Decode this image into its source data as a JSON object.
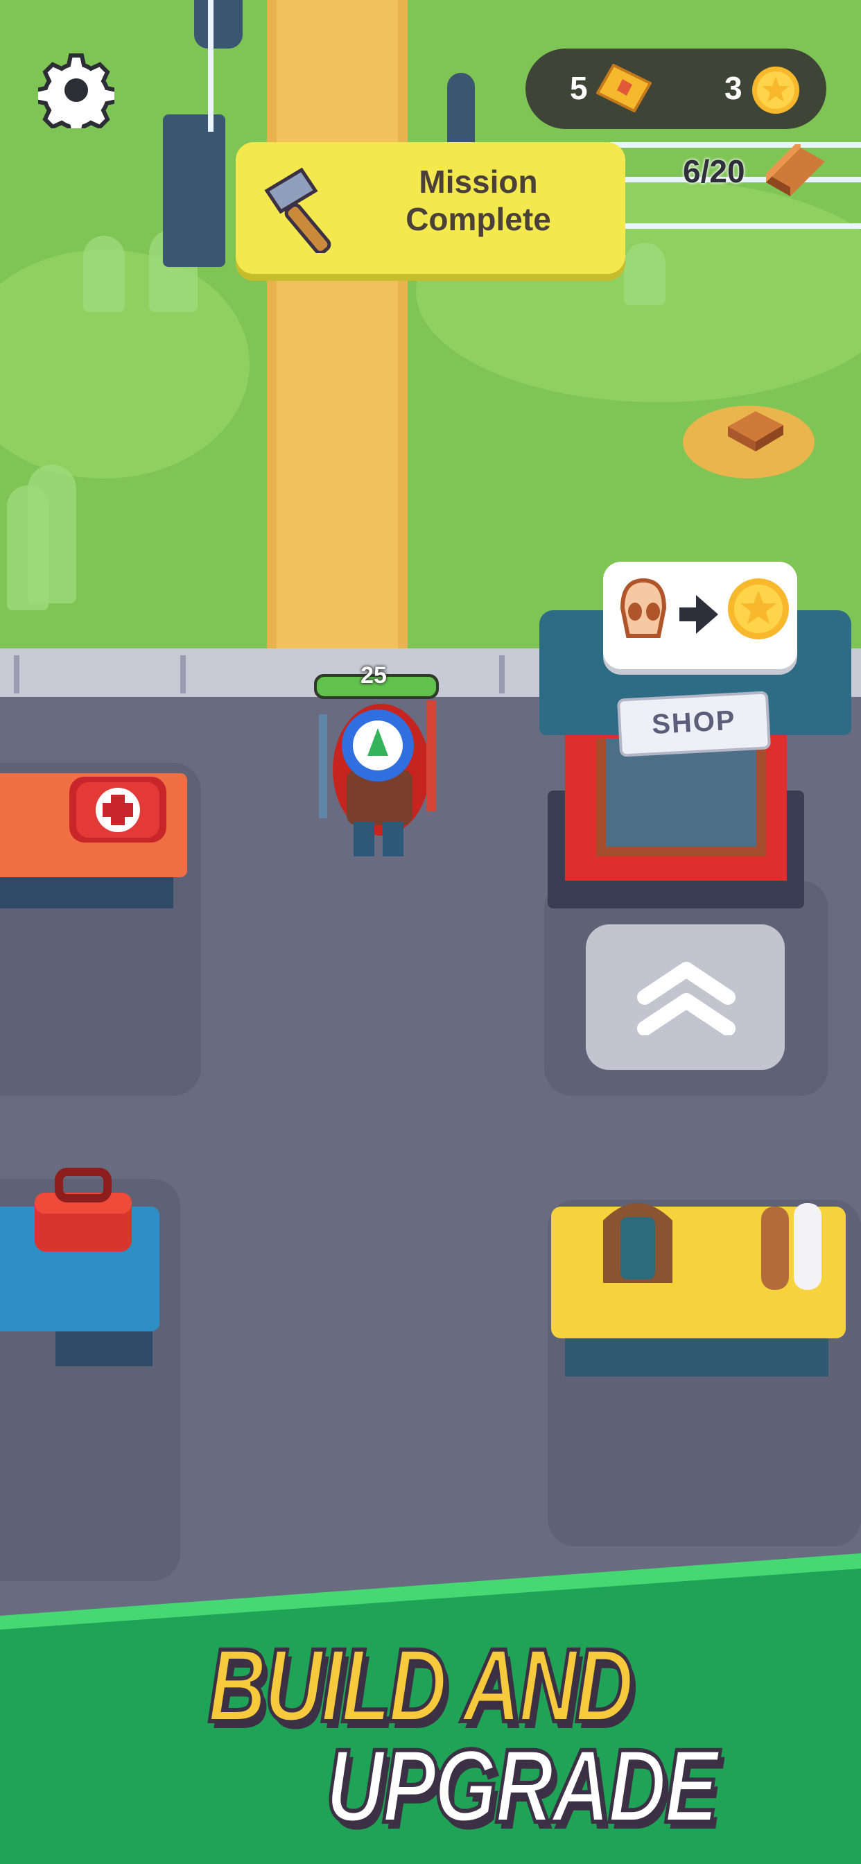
{
  "hud": {
    "tickets_count": "5",
    "coins_count": "3",
    "bricks_progress": "6/20",
    "settings_icon": "gear-icon",
    "ticket_icon": "ticket-icon",
    "coin_icon": "star-coin-icon",
    "brick_icon": "brick-icon"
  },
  "mission": {
    "text": "Mission Complete",
    "icon": "hammer-icon",
    "color": "#f3e94e"
  },
  "player": {
    "health": "25"
  },
  "shop": {
    "sign": "SHOP",
    "trade_from_icon": "skull-icon",
    "trade_arrow_icon": "arrow-right-icon",
    "trade_to_icon": "star-coin-icon"
  },
  "upgrade_pad": {
    "icon": "double-chevron-up-icon"
  },
  "banner": {
    "line1": "BUILD AND",
    "line2": "UPGRADE",
    "line1_color": "#f7c93c",
    "line2_color": "#ffffff",
    "background_color": "#1fa356"
  }
}
